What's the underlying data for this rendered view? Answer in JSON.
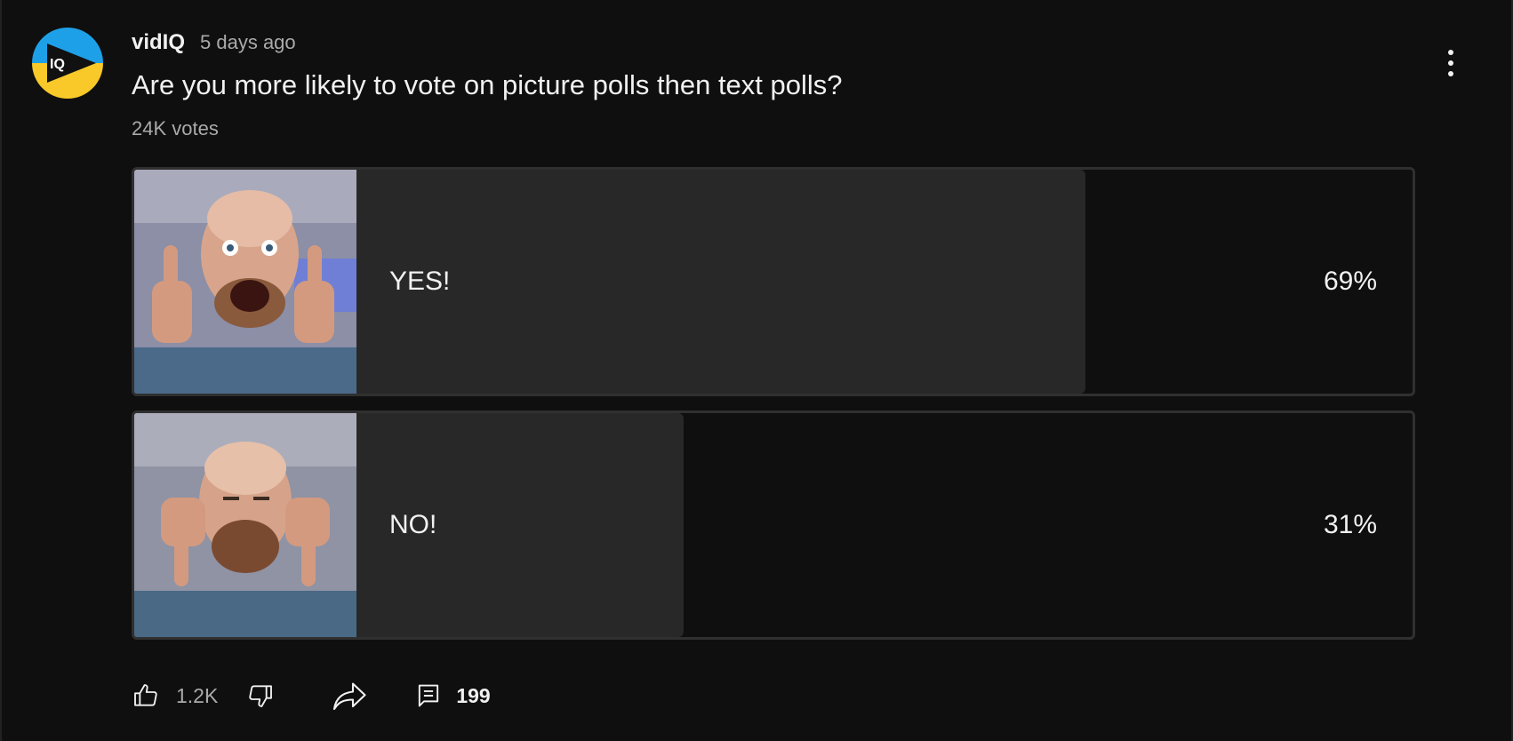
{
  "post": {
    "channel_name": "vidIQ",
    "time": "5 days ago",
    "question": "Are you more likely to vote on picture polls then text polls?",
    "votes": "24K votes",
    "avatar_text": "IQ"
  },
  "poll": {
    "options": [
      {
        "label": "YES!",
        "percent_text": "69%",
        "percent": 69,
        "image_icon": "thumbs-up-photo"
      },
      {
        "label": "NO!",
        "percent_text": "31%",
        "percent": 31,
        "image_icon": "thumbs-down-photo"
      }
    ]
  },
  "actions": {
    "like_count": "1.2K",
    "comment_count": "199"
  },
  "colors": {
    "background": "#0f0f0f",
    "fill": "#282828",
    "border": "#303030",
    "brand_blue": "#1ea0e8",
    "brand_yellow": "#f8c928"
  }
}
